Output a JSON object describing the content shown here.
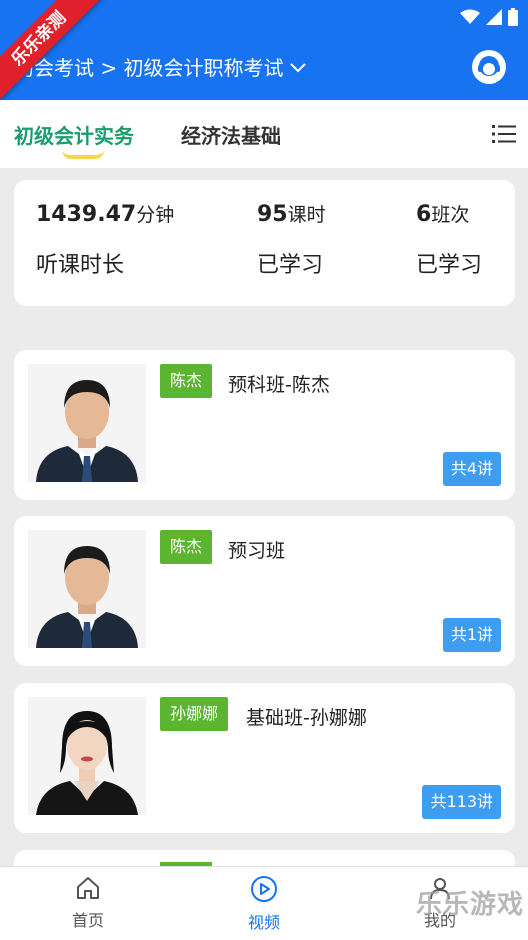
{
  "header": {
    "breadcrumb": "初会考试 > 初级会计职称考试",
    "ribbon_text": "乐乐亲测"
  },
  "tabs": [
    {
      "label": "初级会计实务",
      "active": true
    },
    {
      "label": "经济法基础",
      "active": false
    }
  ],
  "stats": [
    {
      "value": "1439.47",
      "unit": "分钟",
      "label": "听课时长"
    },
    {
      "value": "95",
      "unit": "课时",
      "label": "已学习"
    },
    {
      "value": "6",
      "unit": "班次",
      "label": "已学习"
    }
  ],
  "courses": [
    {
      "teacher": "陈杰",
      "title": "预科班-陈杰",
      "count": "共4讲"
    },
    {
      "teacher": "陈杰",
      "title": "预习班",
      "count": "共1讲"
    },
    {
      "teacher": "孙娜娜",
      "title": "基础班-孙娜娜",
      "count": "共113讲"
    }
  ],
  "nav": {
    "home": "首页",
    "video": "视频",
    "mine": "我的"
  },
  "watermark": "乐乐游戏",
  "colors": {
    "primary_blue": "#1773ef",
    "active_tab_green": "#1a9c6d",
    "teacher_tag_green": "#5cb531",
    "count_badge_blue": "#3f9df0"
  }
}
